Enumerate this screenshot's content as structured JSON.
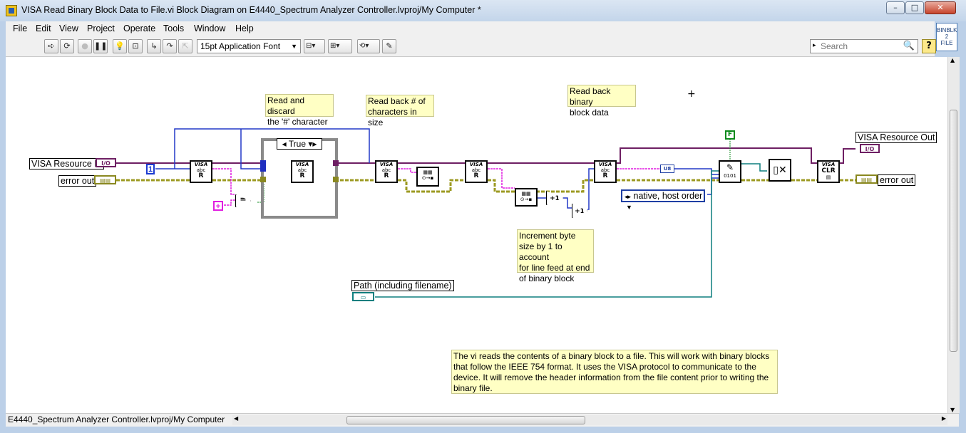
{
  "window": {
    "title": "VISA Read Binary Block Data to File.vi Block Diagram on E4440_Spectrum Analyzer Controller.lvproj/My Computer *",
    "icon": "labview-vi-icon",
    "controls": {
      "minimize": "–",
      "maximize": "□",
      "close": "✕"
    }
  },
  "menubar": {
    "items": [
      "File",
      "Edit",
      "View",
      "Project",
      "Operate",
      "Tools",
      "Window",
      "Help"
    ]
  },
  "toolbar": {
    "font_label": "15pt Application Font",
    "search_placeholder": "Search",
    "help": "?"
  },
  "vi_icon": {
    "line1": "BINBLK",
    "line2": "2",
    "line3": "FILE"
  },
  "diagram": {
    "comments": {
      "read_discard": "Read and discard\nthe '#' character",
      "read_back_size": "Read back # of\ncharacters in size",
      "read_block": "Read back binary\nblock data",
      "increment": "Increment byte\nsize by 1 to account\nfor line feed at end\nof binary block",
      "description": "The vi reads the contents of a binary block to a file.  This will work with binary blocks\nthat follow the IEEE 754 format.  It uses the VISA protocol to communicate to the\ndevice.  It will remove the header information from the file content prior to writing the\nbinary file."
    },
    "labels": {
      "visa_in": "VISA Resource In",
      "error_in": "error out",
      "visa_out": "VISA Resource Out",
      "error_out": "error out",
      "path": "Path (including filename)"
    },
    "case_selector": "True",
    "byte_order": "native, host order",
    "constants": {
      "one": "1",
      "false": "F",
      "hash_char": "+"
    },
    "node_text": {
      "visa": "VISA",
      "abc": "abc",
      "clr": "CLR",
      "io": "I/O",
      "plus1": "+1",
      "equals": "=",
      "read_mode": "R"
    },
    "colors": {
      "error_wire": "#9c9a22",
      "visa_wire": "#6e1f63",
      "string_wire": "#e11ee1",
      "int_wire": "#2238c7",
      "path_wire": "#0f7f7f",
      "bool_wire": "#0d8a1c"
    }
  },
  "status": {
    "project_path": "E4440_Spectrum Analyzer Controller.lvproj/My Computer"
  }
}
